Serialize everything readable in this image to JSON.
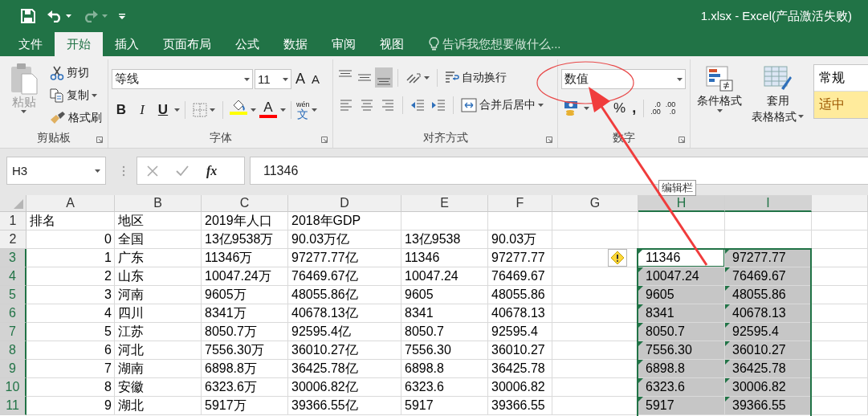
{
  "window": {
    "title": "1.xlsx - Excel(产品激活失败)"
  },
  "quick_access": [
    {
      "kind": "save",
      "disabled": false
    },
    {
      "kind": "undo",
      "disabled": false
    },
    {
      "kind": "redo",
      "disabled": true
    },
    {
      "kind": "customize",
      "disabled": false
    }
  ],
  "tabs": [
    {
      "label": "文件",
      "selected": false
    },
    {
      "label": "开始",
      "selected": true
    },
    {
      "label": "插入",
      "selected": false
    },
    {
      "label": "页面布局",
      "selected": false
    },
    {
      "label": "公式",
      "selected": false
    },
    {
      "label": "数据",
      "selected": false
    },
    {
      "label": "审阅",
      "selected": false
    },
    {
      "label": "视图",
      "selected": false
    }
  ],
  "tell_me": {
    "placeholder": "告诉我您想要做什么..."
  },
  "ribbon": {
    "clipboard": {
      "label": "剪贴板",
      "paste": {
        "label": "粘贴",
        "disabled": true
      },
      "items": [
        {
          "kind": "cut",
          "label": "剪切"
        },
        {
          "kind": "copy",
          "label": "复制"
        },
        {
          "kind": "format_painter",
          "label": "格式刷"
        }
      ]
    },
    "font": {
      "label": "字体",
      "name": "等线",
      "size": "11",
      "grow": "A",
      "shrink": "A",
      "styles": [
        {
          "kind": "bold",
          "label": "B"
        },
        {
          "kind": "italic",
          "label": "I"
        },
        {
          "kind": "underline",
          "label": "U"
        }
      ],
      "fill": {
        "color": "#ffff00"
      },
      "font_color": {
        "label": "A",
        "color": "#ff0000"
      },
      "phonetic": {
        "top": "wén",
        "main": "文"
      }
    },
    "alignment": {
      "label": "对齐方式",
      "vertical": [
        {
          "kind": "top",
          "selected": false
        },
        {
          "kind": "middle",
          "selected": false
        },
        {
          "kind": "bottom",
          "selected": true
        }
      ],
      "horizontal": [
        {
          "kind": "left",
          "selected": false
        },
        {
          "kind": "center",
          "selected": false
        },
        {
          "kind": "right",
          "selected": false
        }
      ],
      "wrap": "自动换行",
      "merge": "合并后居中"
    },
    "number": {
      "label": "数字",
      "format": "数值",
      "percent": "%",
      "comma": ",",
      "increase_decimal": [
        ".0",
        ".00"
      ],
      "decrease_decimal": [
        ".00",
        ".0"
      ]
    },
    "styles": {
      "conditional": "条件格式",
      "table": [
        "套用",
        "表格格式"
      ],
      "gallery": [
        {
          "kind": "normal",
          "label": "常规"
        },
        {
          "kind": "neutral",
          "label": "适中"
        }
      ]
    }
  },
  "formula_bar": {
    "name_box": "H3",
    "fx": "fx",
    "value": "11346"
  },
  "tooltip": "编辑栏",
  "sheet": {
    "columns": [
      {
        "letter": "A",
        "selected": false
      },
      {
        "letter": "B",
        "selected": false
      },
      {
        "letter": "C",
        "selected": false
      },
      {
        "letter": "D",
        "selected": false
      },
      {
        "letter": "E",
        "selected": false
      },
      {
        "letter": "F",
        "selected": false
      },
      {
        "letter": "G",
        "selected": false
      },
      {
        "letter": "H",
        "selected": true
      },
      {
        "letter": "I",
        "selected": true
      }
    ],
    "rows": [
      {
        "number": "1",
        "selected": false,
        "cells": {
          "A": {
            "text": "排名",
            "kind": "text",
            "selected": false,
            "active": false
          },
          "B": {
            "text": "地区",
            "kind": "text",
            "selected": false,
            "active": false
          },
          "C": {
            "text": "2019年人口",
            "kind": "text",
            "selected": false,
            "active": false
          },
          "D": {
            "text": "2018年GDP",
            "kind": "text",
            "selected": false,
            "active": false
          }
        }
      },
      {
        "number": "2",
        "selected": false,
        "cells": {
          "A": {
            "text": "0",
            "kind": "number",
            "selected": false,
            "active": false
          },
          "B": {
            "text": "全国",
            "kind": "text",
            "selected": false,
            "active": false
          },
          "C": {
            "text": "13亿9538万",
            "kind": "text",
            "selected": false,
            "active": false
          },
          "D": {
            "text": "90.03万亿",
            "kind": "text",
            "selected": false,
            "active": false
          },
          "E": {
            "text": "13亿9538",
            "kind": "text",
            "selected": false,
            "active": false
          },
          "F": {
            "text": "90.03万",
            "kind": "text",
            "selected": false,
            "active": false
          }
        }
      },
      {
        "number": "3",
        "selected": true,
        "cells": {
          "A": {
            "text": "1",
            "kind": "number",
            "selected": false,
            "active": false
          },
          "B": {
            "text": "广东",
            "kind": "text",
            "selected": false,
            "active": false
          },
          "C": {
            "text": "11346万",
            "kind": "text",
            "selected": false,
            "active": false
          },
          "D": {
            "text": "97277.77亿",
            "kind": "text",
            "selected": false,
            "active": false
          },
          "E": {
            "text": "11346",
            "kind": "text",
            "selected": false,
            "active": false
          },
          "F": {
            "text": "97277.77",
            "kind": "text",
            "selected": false,
            "active": false
          },
          "G": {
            "kind": "warning",
            "selected": false,
            "active": false
          },
          "H": {
            "text": "11346",
            "kind": "stored_text",
            "selected": true,
            "active": true
          },
          "I": {
            "text": "97277.77",
            "kind": "stored_text",
            "selected": true,
            "active": false
          }
        }
      },
      {
        "number": "4",
        "selected": true,
        "cells": {
          "A": {
            "text": "2",
            "kind": "number",
            "selected": false,
            "active": false
          },
          "B": {
            "text": "山东",
            "kind": "text",
            "selected": false,
            "active": false
          },
          "C": {
            "text": "10047.24万",
            "kind": "text",
            "selected": false,
            "active": false
          },
          "D": {
            "text": "76469.67亿",
            "kind": "text",
            "selected": false,
            "active": false
          },
          "E": {
            "text": "10047.24",
            "kind": "text",
            "selected": false,
            "active": false
          },
          "F": {
            "text": "76469.67",
            "kind": "text",
            "selected": false,
            "active": false
          },
          "H": {
            "text": "10047.24",
            "kind": "stored_text",
            "selected": true,
            "active": false
          },
          "I": {
            "text": "76469.67",
            "kind": "stored_text",
            "selected": true,
            "active": false
          }
        }
      },
      {
        "number": "5",
        "selected": true,
        "cells": {
          "A": {
            "text": "3",
            "kind": "number",
            "selected": false,
            "active": false
          },
          "B": {
            "text": "河南",
            "kind": "text",
            "selected": false,
            "active": false
          },
          "C": {
            "text": "9605万",
            "kind": "text",
            "selected": false,
            "active": false
          },
          "D": {
            "text": "48055.86亿",
            "kind": "text",
            "selected": false,
            "active": false
          },
          "E": {
            "text": "9605",
            "kind": "text",
            "selected": false,
            "active": false
          },
          "F": {
            "text": "48055.86",
            "kind": "text",
            "selected": false,
            "active": false
          },
          "H": {
            "text": "9605",
            "kind": "stored_text",
            "selected": true,
            "active": false
          },
          "I": {
            "text": "48055.86",
            "kind": "stored_text",
            "selected": true,
            "active": false
          }
        }
      },
      {
        "number": "6",
        "selected": true,
        "cells": {
          "A": {
            "text": "4",
            "kind": "number",
            "selected": false,
            "active": false
          },
          "B": {
            "text": "四川",
            "kind": "text",
            "selected": false,
            "active": false
          },
          "C": {
            "text": "8341万",
            "kind": "text",
            "selected": false,
            "active": false
          },
          "D": {
            "text": "40678.13亿",
            "kind": "text",
            "selected": false,
            "active": false
          },
          "E": {
            "text": "8341",
            "kind": "text",
            "selected": false,
            "active": false
          },
          "F": {
            "text": "40678.13",
            "kind": "text",
            "selected": false,
            "active": false
          },
          "H": {
            "text": "8341",
            "kind": "stored_text",
            "selected": true,
            "active": false
          },
          "I": {
            "text": "40678.13",
            "kind": "stored_text",
            "selected": true,
            "active": false
          }
        }
      },
      {
        "number": "7",
        "selected": true,
        "cells": {
          "A": {
            "text": "5",
            "kind": "number",
            "selected": false,
            "active": false
          },
          "B": {
            "text": "江苏",
            "kind": "text",
            "selected": false,
            "active": false
          },
          "C": {
            "text": "8050.7万",
            "kind": "text",
            "selected": false,
            "active": false
          },
          "D": {
            "text": "92595.4亿",
            "kind": "text",
            "selected": false,
            "active": false
          },
          "E": {
            "text": "8050.7",
            "kind": "text",
            "selected": false,
            "active": false
          },
          "F": {
            "text": "92595.4",
            "kind": "text",
            "selected": false,
            "active": false
          },
          "H": {
            "text": "8050.7",
            "kind": "stored_text",
            "selected": true,
            "active": false
          },
          "I": {
            "text": "92595.4",
            "kind": "stored_text",
            "selected": true,
            "active": false
          }
        }
      },
      {
        "number": "8",
        "selected": true,
        "cells": {
          "A": {
            "text": "6",
            "kind": "number",
            "selected": false,
            "active": false
          },
          "B": {
            "text": "河北",
            "kind": "text",
            "selected": false,
            "active": false
          },
          "C": {
            "text": "7556.30万",
            "kind": "text",
            "selected": false,
            "active": false
          },
          "D": {
            "text": "36010.27亿",
            "kind": "text",
            "selected": false,
            "active": false
          },
          "E": {
            "text": "7556.30",
            "kind": "text",
            "selected": false,
            "active": false
          },
          "F": {
            "text": "36010.27",
            "kind": "text",
            "selected": false,
            "active": false
          },
          "H": {
            "text": "7556.30",
            "kind": "stored_text",
            "selected": true,
            "active": false
          },
          "I": {
            "text": "36010.27",
            "kind": "stored_text",
            "selected": true,
            "active": false
          }
        }
      },
      {
        "number": "9",
        "selected": true,
        "cells": {
          "A": {
            "text": "7",
            "kind": "number",
            "selected": false,
            "active": false
          },
          "B": {
            "text": "湖南",
            "kind": "text",
            "selected": false,
            "active": false
          },
          "C": {
            "text": "6898.8万",
            "kind": "text",
            "selected": false,
            "active": false
          },
          "D": {
            "text": "36425.78亿",
            "kind": "text",
            "selected": false,
            "active": false
          },
          "E": {
            "text": "6898.8",
            "kind": "text",
            "selected": false,
            "active": false
          },
          "F": {
            "text": "36425.78",
            "kind": "text",
            "selected": false,
            "active": false
          },
          "H": {
            "text": "6898.8",
            "kind": "stored_text",
            "selected": true,
            "active": false
          },
          "I": {
            "text": "36425.78",
            "kind": "stored_text",
            "selected": true,
            "active": false
          }
        }
      },
      {
        "number": "10",
        "selected": true,
        "cells": {
          "A": {
            "text": "8",
            "kind": "number",
            "selected": false,
            "active": false
          },
          "B": {
            "text": "安徽",
            "kind": "text",
            "selected": false,
            "active": false
          },
          "C": {
            "text": "6323.6万",
            "kind": "text",
            "selected": false,
            "active": false
          },
          "D": {
            "text": "30006.82亿",
            "kind": "text",
            "selected": false,
            "active": false
          },
          "E": {
            "text": "6323.6",
            "kind": "text",
            "selected": false,
            "active": false
          },
          "F": {
            "text": "30006.82",
            "kind": "text",
            "selected": false,
            "active": false
          },
          "H": {
            "text": "6323.6",
            "kind": "stored_text",
            "selected": true,
            "active": false
          },
          "I": {
            "text": "30006.82",
            "kind": "stored_text",
            "selected": true,
            "active": false
          }
        }
      },
      {
        "number": "11",
        "selected": true,
        "cells": {
          "A": {
            "text": "9",
            "kind": "number",
            "selected": false,
            "active": false
          },
          "B": {
            "text": "湖北",
            "kind": "text",
            "selected": false,
            "active": false
          },
          "C": {
            "text": "5917万",
            "kind": "text",
            "selected": false,
            "active": false
          },
          "D": {
            "text": "39366.55亿",
            "kind": "text",
            "selected": false,
            "active": false
          },
          "E": {
            "text": "5917",
            "kind": "text",
            "selected": false,
            "active": false
          },
          "F": {
            "text": "39366.55",
            "kind": "text",
            "selected": false,
            "active": false
          },
          "H": {
            "text": "5917",
            "kind": "stored_text",
            "selected": true,
            "active": false
          },
          "I": {
            "text": "39366.55",
            "kind": "stored_text",
            "selected": true,
            "active": false
          }
        }
      }
    ]
  },
  "annotations": [
    {
      "kind": "ellipse"
    },
    {
      "kind": "arrow"
    }
  ]
}
